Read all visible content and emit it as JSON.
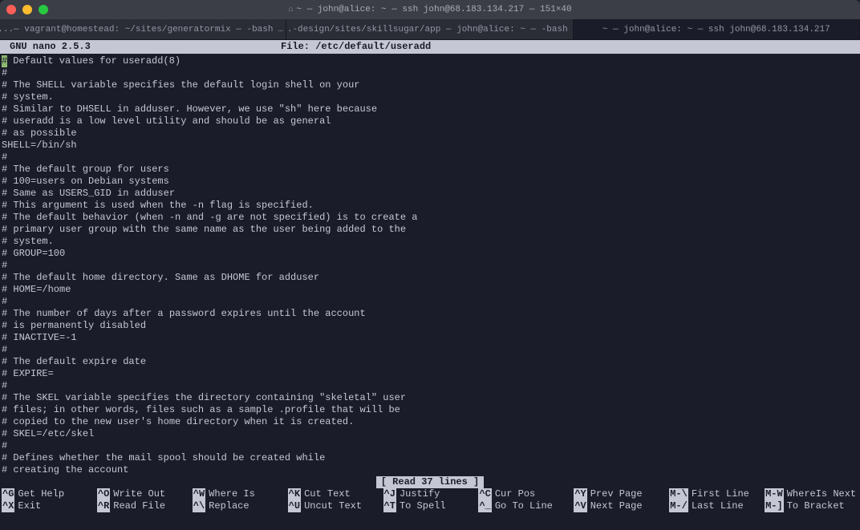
{
  "title": "~ — john@alice: ~ — ssh john@68.183.134.217 — 151×40",
  "tabs": [
    {
      "label": "...— vagrant@homestead: ~/sites/generatormix — -bash",
      "active": false,
      "ellipsis": "…"
    },
    {
      "label": "...-design/sites/skillsugar/app — john@alice: ~ — -bash",
      "active": false,
      "ellipsis": "…"
    },
    {
      "label": "~ — john@alice: ~ — ssh john@68.183.134.217",
      "active": true,
      "ellipsis": ""
    }
  ],
  "header": {
    "app": "  GNU nano 2.5.3",
    "file": "File: /etc/default/useradd"
  },
  "lines": [
    " Default values for useradd(8)",
    "#",
    "# The SHELL variable specifies the default login shell on your",
    "# system.",
    "# Similar to DHSELL in adduser. However, we use \"sh\" here because",
    "# useradd is a low level utility and should be as general",
    "# as possible",
    "SHELL=/bin/sh",
    "#",
    "# The default group for users",
    "# 100=users on Debian systems",
    "# Same as USERS_GID in adduser",
    "# This argument is used when the -n flag is specified.",
    "# The default behavior (when -n and -g are not specified) is to create a",
    "# primary user group with the same name as the user being added to the",
    "# system.",
    "# GROUP=100",
    "#",
    "# The default home directory. Same as DHOME for adduser",
    "# HOME=/home",
    "#",
    "# The number of days after a password expires until the account",
    "# is permanently disabled",
    "# INACTIVE=-1",
    "#",
    "# The default expire date",
    "# EXPIRE=",
    "#",
    "# The SKEL variable specifies the directory containing \"skeletal\" user",
    "# files; in other words, files such as a sample .profile that will be",
    "# copied to the new user's home directory when it is created.",
    "# SKEL=/etc/skel",
    "#",
    "# Defines whether the mail spool should be created while",
    "# creating the account"
  ],
  "first_line_cursor": "#",
  "status": "[ Read 37 lines ]",
  "shortcuts_row1": [
    {
      "key": "^G",
      "label": "Get Help"
    },
    {
      "key": "^O",
      "label": "Write Out"
    },
    {
      "key": "^W",
      "label": "Where Is"
    },
    {
      "key": "^K",
      "label": "Cut Text"
    },
    {
      "key": "^J",
      "label": "Justify"
    },
    {
      "key": "^C",
      "label": "Cur Pos"
    },
    {
      "key": "^Y",
      "label": "Prev Page"
    },
    {
      "key": "M-\\",
      "label": "First Line"
    },
    {
      "key": "M-W",
      "label": "WhereIs Next"
    }
  ],
  "shortcuts_row2": [
    {
      "key": "^X",
      "label": "Exit"
    },
    {
      "key": "^R",
      "label": "Read File"
    },
    {
      "key": "^\\",
      "label": "Replace"
    },
    {
      "key": "^U",
      "label": "Uncut Text"
    },
    {
      "key": "^T",
      "label": "To Spell"
    },
    {
      "key": "^_",
      "label": "Go To Line"
    },
    {
      "key": "^V",
      "label": "Next Page"
    },
    {
      "key": "M-/",
      "label": "Last Line"
    },
    {
      "key": "M-]",
      "label": "To Bracket"
    }
  ]
}
